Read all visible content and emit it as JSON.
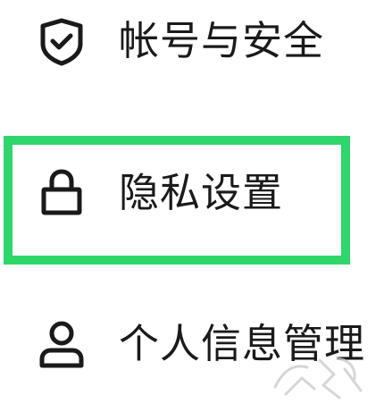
{
  "menu": {
    "items": [
      {
        "label": "帐号与安全",
        "icon": "shield-check-icon"
      },
      {
        "label": "隐私设置",
        "icon": "lock-icon",
        "highlighted": true
      },
      {
        "label": "个人信息管理",
        "icon": "user-icon"
      }
    ]
  },
  "colors": {
    "highlight": "#2fd66b",
    "text": "#1a1a1a",
    "icon": "#1a1a1a"
  }
}
